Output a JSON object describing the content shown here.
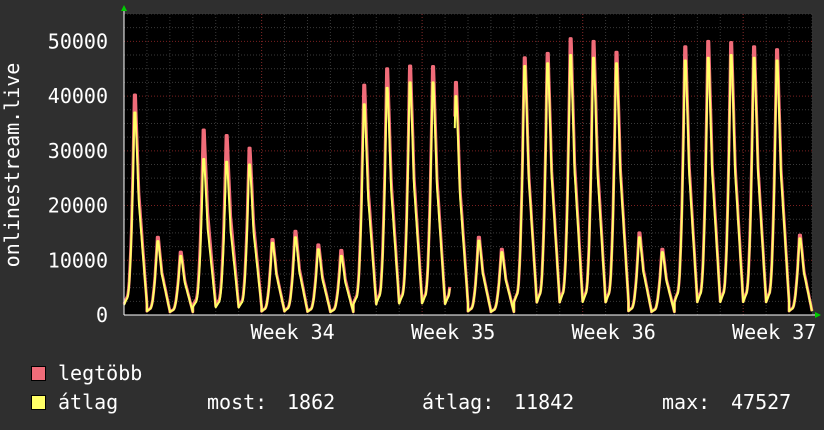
{
  "chart_data": {
    "type": "area",
    "ylabel": "onlinestream.live",
    "ylim": [
      0,
      55000
    ],
    "yticks": [
      0,
      10000,
      20000,
      30000,
      40000,
      50000
    ],
    "ytick_labels": [
      "0",
      "10000",
      "20000",
      "30000",
      "40000",
      "50000"
    ],
    "x_tick_labels": [
      "Week 34",
      "Week 35",
      "Week 36",
      "Week 37"
    ],
    "x_units": "days",
    "xlim": [
      0,
      30
    ],
    "x_ticks": [
      6,
      13,
      20,
      27
    ],
    "grid": true,
    "series": [
      {
        "name": "legtöbb",
        "color": "#f06c79"
      },
      {
        "name": "átlag",
        "color": "#ffff66"
      }
    ],
    "daily_peaks": {
      "days": [
        0,
        1,
        2,
        3,
        4,
        5,
        6,
        7,
        8,
        9,
        10,
        11,
        12,
        13,
        14,
        15,
        16,
        17,
        18,
        19,
        20,
        21,
        22,
        23,
        24,
        25,
        26,
        27,
        28,
        29,
        30
      ],
      "legtöbb": [
        40200,
        14200,
        11500,
        33800,
        32800,
        30500,
        13800,
        15300,
        12800,
        11800,
        42000,
        45000,
        45500,
        45400,
        42500,
        14200,
        12000,
        47000,
        47800,
        50500,
        50000,
        48000,
        15000,
        12000,
        49000,
        50000,
        49800,
        49000,
        48500,
        14600,
        0
      ],
      "átlag": [
        37000,
        13500,
        10800,
        28500,
        28000,
        27500,
        13200,
        14200,
        12000,
        10800,
        38500,
        41500,
        42500,
        42500,
        40000,
        13600,
        11500,
        45500,
        46000,
        47500,
        47000,
        46000,
        14200,
        11500,
        46500,
        47000,
        47500,
        47000,
        46500,
        14000,
        0
      ]
    },
    "gap_after_day": 14.2
  },
  "legend": {
    "items": [
      {
        "label": "legtöbb",
        "color": "#f06c79"
      },
      {
        "label": "átlag",
        "color": "#ffff66"
      }
    ],
    "stats": [
      {
        "label": "most:",
        "value": "1862"
      },
      {
        "label": "átlag:",
        "value": "11842"
      },
      {
        "label": "max:",
        "value": "47527"
      }
    ]
  },
  "colors": {
    "background": "#2f2f2f",
    "plot_background": "#000000",
    "grid_major": "#7a2020",
    "grid_minor": "#3a3a3a",
    "axis_arrow": "#00cc00"
  }
}
